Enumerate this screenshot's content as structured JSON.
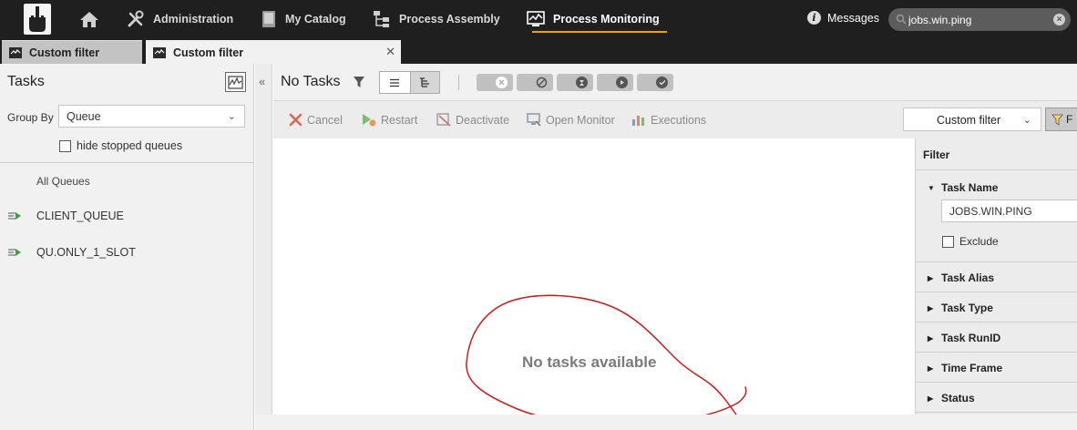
{
  "nav": {
    "items": [
      {
        "label": ""
      },
      {
        "label": "Administration"
      },
      {
        "label": "My Catalog"
      },
      {
        "label": "Process Assembly"
      },
      {
        "label": "Process Monitoring"
      }
    ],
    "messages_label": "Messages",
    "search_value": "jobs.win.ping",
    "accent_color": "#e8a11a"
  },
  "tabs": [
    {
      "label": "Custom filter"
    },
    {
      "label": "Custom filter"
    }
  ],
  "left": {
    "title": "Tasks",
    "group_by_label": "Group By",
    "group_by_value": "Queue",
    "hide_stopped_label": "hide stopped queues",
    "queues": [
      "All Queues",
      "CLIENT_QUEUE",
      "QU.ONLY_1_SLOT"
    ]
  },
  "main": {
    "title": "No Tasks",
    "actions": [
      "Cancel",
      "Restart",
      "Deactivate",
      "Open Monitor",
      "Executions"
    ],
    "filter_select_value": "Custom filter",
    "filter_button_label": "F",
    "empty_message": "No tasks available",
    "annotation_color": "#d11a1a"
  },
  "filter_panel": {
    "title": "Filter",
    "sections": [
      "Task Name",
      "Task Alias",
      "Task Type",
      "Task RunID",
      "Time Frame",
      "Status"
    ],
    "task_name_value": "JOBS.WIN.PING",
    "exclude_label": "Exclude"
  }
}
